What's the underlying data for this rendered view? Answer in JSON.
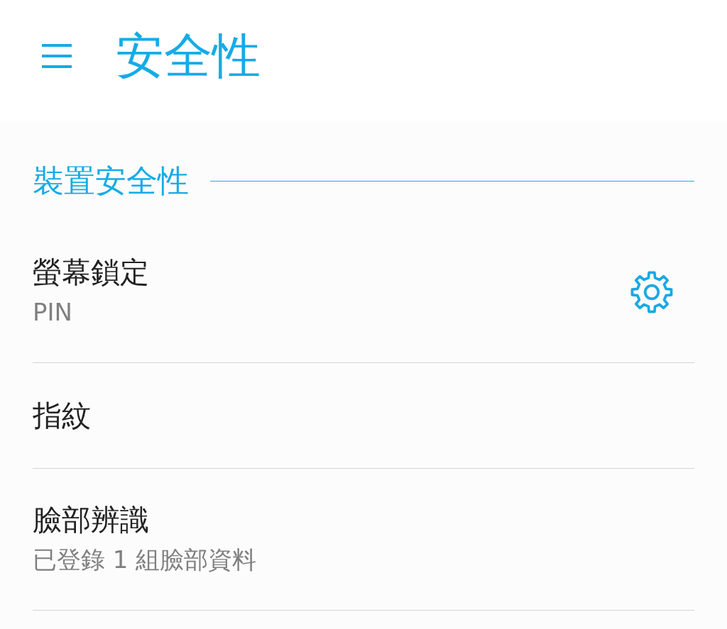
{
  "app_bar": {
    "title": "安全性"
  },
  "sections": [
    {
      "title": "裝置安全性",
      "items": [
        {
          "kind": "settings",
          "title": "螢幕鎖定",
          "summary": "PIN"
        },
        {
          "kind": "plain",
          "title": "指紋"
        },
        {
          "kind": "plain",
          "title": "臉部辨識",
          "summary": "已登錄 1 組臉部資料"
        }
      ]
    }
  ]
}
